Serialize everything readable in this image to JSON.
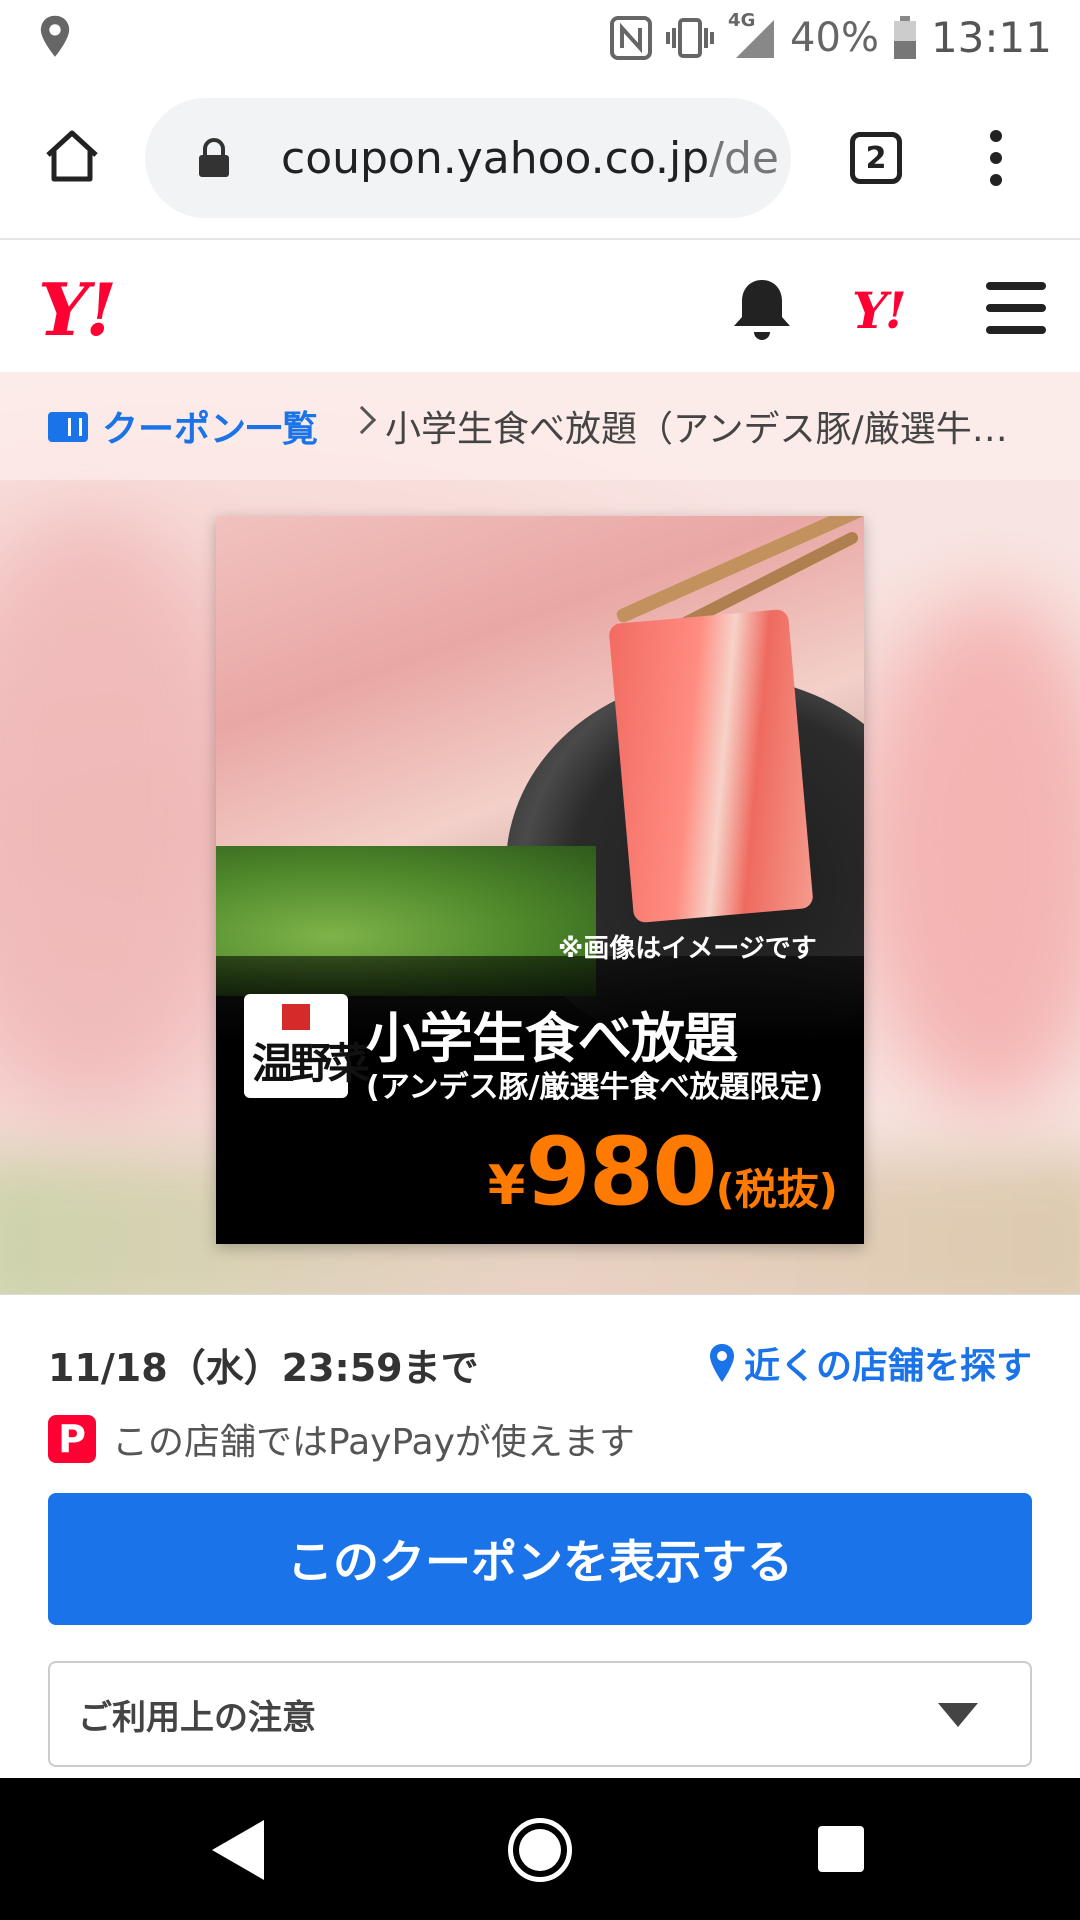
{
  "status_bar": {
    "network": "4G",
    "battery": "40%",
    "time": "13:11"
  },
  "browser": {
    "url_main": "coupon.yahoo.co.jp",
    "url_rest": "/de",
    "tab_count": "2"
  },
  "header": {
    "logo": "Y!",
    "logo_small": "Y!"
  },
  "breadcrumb": {
    "link_label": "クーポン一覧",
    "current": "小学生食べ放題（アンデス豚/厳選牛…"
  },
  "coupon": {
    "image_note": "※画像はイメージです",
    "title": "小学生食べ放題",
    "subtitle": "(アンデス豚/厳選牛食べ放題限定)",
    "price_symbol": "¥",
    "price_value": "980",
    "price_tax": "(税抜)",
    "shop_logo_text": "温野菜"
  },
  "details": {
    "deadline": "11/18（水）23:59まで",
    "nearby_link": "近くの店舗を探す",
    "paypay_icon": "P",
    "paypay_text": "この店舗ではPayPayが使えます",
    "show_button": "このクーポンを表示する",
    "notice_label": "ご利用上の注意"
  },
  "colors": {
    "accent_blue": "#1a73e8",
    "yahoo_red": "#ff0033",
    "price_orange": "#ff7a00"
  }
}
